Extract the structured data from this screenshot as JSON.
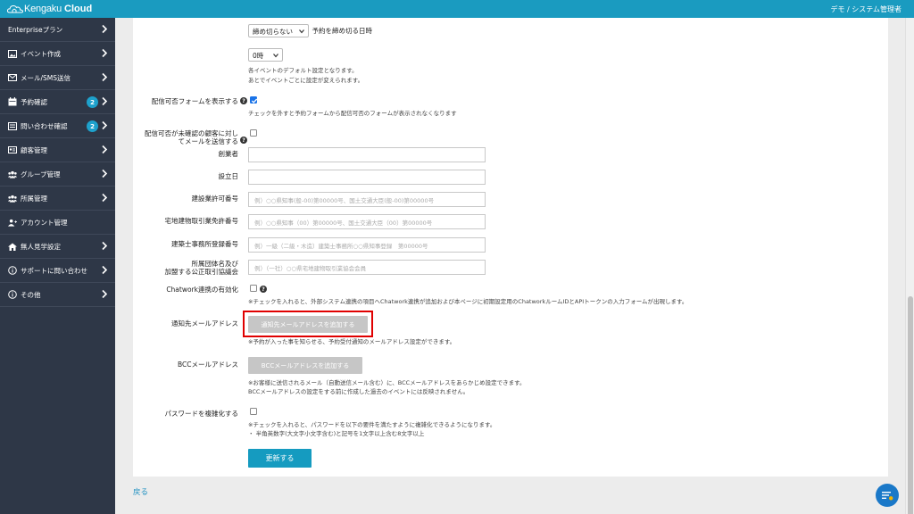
{
  "header": {
    "brand_part1": "Kengaku",
    "brand_part2": "Cloud",
    "user_label": "デモ / システム管理者"
  },
  "sidebar": {
    "items": [
      {
        "label": "Enterpriseプラン",
        "icon": "none"
      },
      {
        "label": "イベント作成",
        "icon": "image-icon"
      },
      {
        "label": "メール/SMS送信",
        "icon": "envelope-icon"
      },
      {
        "label": "予約確認",
        "icon": "calendar-icon",
        "badge": "2"
      },
      {
        "label": "問い合わせ確認",
        "icon": "inbox-icon",
        "badge": "2"
      },
      {
        "label": "顧客管理",
        "icon": "id-card-icon"
      },
      {
        "label": "グループ管理",
        "icon": "group-icon"
      },
      {
        "label": "所属管理",
        "icon": "group-icon"
      },
      {
        "label": "アカウント管理",
        "icon": "user-plus-icon"
      },
      {
        "label": "無人見学設定",
        "icon": "home-icon"
      },
      {
        "label": "サポートに問い合わせ",
        "icon": "info-icon"
      },
      {
        "label": "その他",
        "icon": "info-icon"
      }
    ]
  },
  "form": {
    "deadline_label": "予約を締め切る日時",
    "deadline_select": "締め切らない",
    "hour_select": "0時",
    "deadline_note_1": "各イベントのデフォルト設定となります。",
    "deadline_note_2": "あとでイベントごとに設定が変えられます。",
    "optout_form_label": "配信可否フォームを表示する",
    "optout_form_checked": true,
    "optout_form_note": "チェックを外すと予約フォームから配信可否のフォームが表示されなくなります",
    "unconfirmed_label_1": "配信可否が未確認の顧客に対し",
    "unconfirmed_label_2": "てメールを送信する",
    "founder_label": "創業者",
    "founder_value": "",
    "established_label": "設立日",
    "established_value": "",
    "construction_license_label": "建設業許可番号",
    "construction_license_placeholder": "例）○○県知事(般-00)第00000号、国土交通大臣(般-00)第00000号",
    "realestate_license_label": "宅地建物取引業免許番号",
    "realestate_license_placeholder": "例）○○県知事（00）第00000号、国土交通大臣（00）第00000号",
    "architect_office_label": "建築士事務所登録番号",
    "architect_office_placeholder": "例）一級（二級・木造）建築士事務所○○県知事登録　第00000号",
    "association_label_1": "所属団体名及び",
    "association_label_2": "加盟する公正取引協議会",
    "association_placeholder": "例）（一社）○○県宅地建物取引業協会会員",
    "chatwork_label": "Chatwork連携の有効化",
    "chatwork_note": "※チェックを入れると、外部システム連携の項目へChatwork連携が追加および本ページに初期設定用のChatworkルームIDとAPIトークンの入力フォームが出現します。",
    "notify_email_label": "通知先メールアドレス",
    "notify_email_button": "通知先メールアドレスを追加する",
    "notify_email_note": "※予約が入った事を知らせる、予約受付通知のメールアドレス設定ができます。",
    "bcc_label": "BCCメールアドレス",
    "bcc_button": "BCCメールアドレスを追加する",
    "bcc_note_1": "※お客様に送信されるメール（自動送信メール含む）に、BCCメールアドレスをあらかじめ設定できます。",
    "bcc_note_2": "BCCメールアドレスの設定をする前に作成した過去のイベントには反映されません。",
    "password_label": "パスワードを複雑化する",
    "password_note_1": "※チェックを入れると、パスワードを以下の要件を満たすように複雑化できるようになります。",
    "password_note_2": "・ 半角英数字(大文字小文字含む)と記号を1文字以上含む8文字以上",
    "update_button": "更新する"
  },
  "footer": {
    "back_link": "戻る"
  },
  "colors": {
    "topbar": "#1a9bc0",
    "sidebar": "#2e3747",
    "badge": "#1ea1cc",
    "primary": "#159bc0",
    "highlight": "#e00000"
  }
}
